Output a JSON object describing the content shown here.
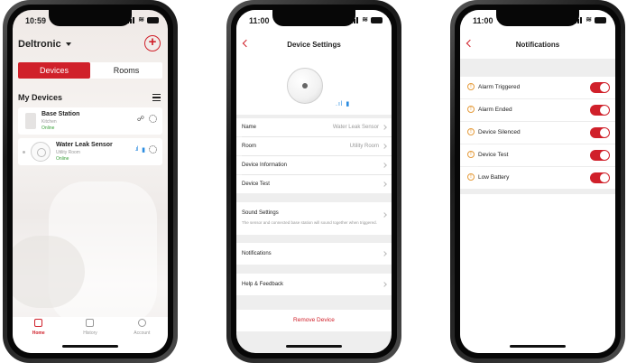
{
  "phone1": {
    "time": "10:59",
    "brand": "Deltronic",
    "tabs": [
      "Devices",
      "Rooms"
    ],
    "section_title": "My Devices",
    "devices": [
      {
        "name": "Base Station",
        "room": "Kitchen",
        "status": "Online"
      },
      {
        "name": "Water Leak Sensor",
        "room": "Utility Room",
        "status": "Online"
      }
    ],
    "bottom_tabs": [
      "Home",
      "History",
      "Account"
    ]
  },
  "phone2": {
    "time": "11:00",
    "title": "Device Settings",
    "rows": {
      "name_label": "Name",
      "name_value": "Water Leak Sensor",
      "room_label": "Room",
      "room_value": "Utility Room",
      "device_info": "Device Information",
      "device_test": "Device Test",
      "sound_settings": "Sound Settings",
      "sound_desc": "The sensor and connected base station will sound together when triggered.",
      "notifications": "Notifications",
      "help": "Help & Feedback",
      "remove": "Remove Device"
    }
  },
  "phone3": {
    "time": "11:00",
    "title": "Notifications",
    "items": [
      {
        "label": "Alarm Triggered",
        "enabled": true
      },
      {
        "label": "Alarm Ended",
        "enabled": true
      },
      {
        "label": "Device Silenced",
        "enabled": true
      },
      {
        "label": "Device Test",
        "enabled": true
      },
      {
        "label": "Low Battery",
        "enabled": true
      }
    ]
  },
  "colors": {
    "accent": "#d0202a",
    "online": "#3aa03a",
    "signal": "#2b8ce0",
    "warning": "#e59b3a"
  }
}
